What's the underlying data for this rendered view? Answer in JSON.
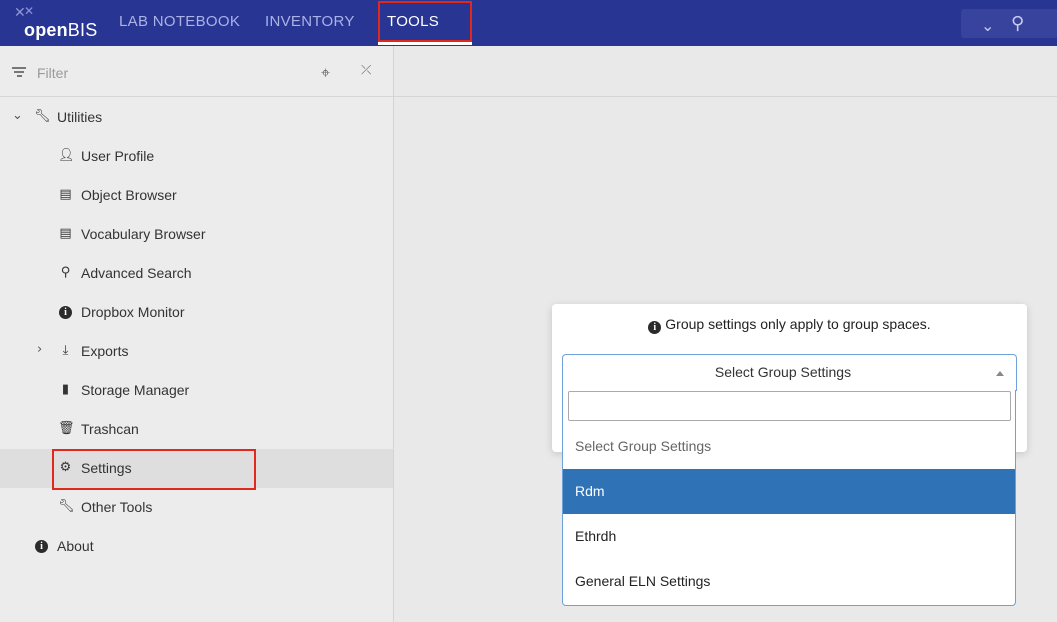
{
  "app": {
    "logo_prefix": "open",
    "logo_suffix": "BIS"
  },
  "nav": {
    "tabs": [
      {
        "label": "LAB NOTEBOOK"
      },
      {
        "label": "INVENTORY"
      },
      {
        "label": "TOOLS"
      }
    ],
    "active_tab": "TOOLS"
  },
  "sidebar": {
    "filter_placeholder": "Filter",
    "items": [
      {
        "label": "Utilities",
        "icon": "wrench-icon"
      },
      {
        "label": "User Profile",
        "icon": "user-icon"
      },
      {
        "label": "Object Browser",
        "icon": "list-icon"
      },
      {
        "label": "Vocabulary Browser",
        "icon": "list-icon"
      },
      {
        "label": "Advanced Search",
        "icon": "search-icon"
      },
      {
        "label": "Dropbox Monitor",
        "icon": "info-icon"
      },
      {
        "label": "Exports",
        "icon": "export-icon"
      },
      {
        "label": "Storage Manager",
        "icon": "file-icon"
      },
      {
        "label": "Trashcan",
        "icon": "trash-icon"
      },
      {
        "label": "Settings",
        "icon": "gear-icon"
      },
      {
        "label": "Other Tools",
        "icon": "wrench-icon"
      },
      {
        "label": "About",
        "icon": "info-icon"
      }
    ],
    "selected": "Settings"
  },
  "modal": {
    "note": "Group settings only apply to group spaces.",
    "select": {
      "value": "Select Group Settings",
      "search_value": "",
      "options": [
        {
          "label": "Select Group Settings"
        },
        {
          "label": "Rdm"
        },
        {
          "label": "Ethrdh"
        },
        {
          "label": "General ELN Settings"
        }
      ],
      "highlighted": "Rdm"
    }
  },
  "colors": {
    "topbar": "#283593",
    "highlight_box": "#e0281c",
    "option_highlight": "#2f72b5",
    "select_border": "#6fa1d8"
  }
}
